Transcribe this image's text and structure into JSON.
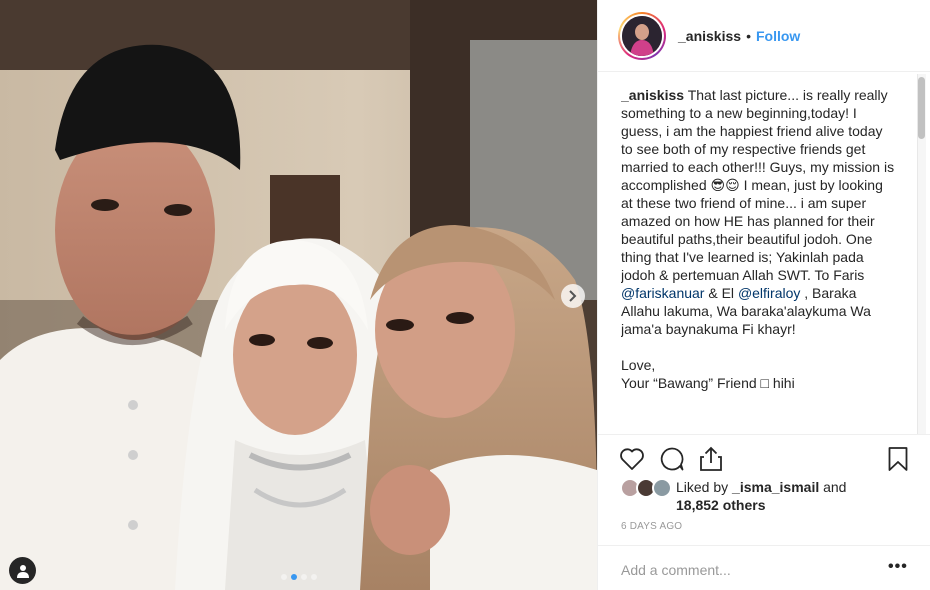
{
  "post": {
    "author": "_aniskiss",
    "separator": "•",
    "follow_label": "Follow",
    "caption": {
      "username": "_aniskiss",
      "part1": " That last picture... is really really something to a new beginning,today! I guess, i am the happiest friend alive today to see both of my respective friends get married to each other!!! Guys, my mission is accomplished 😎😌 I mean, just by looking at these two friend of mine... i am super amazed on how HE has planned for their beautiful paths,their beautiful jodoh. One thing that I've learned is; Yakinlah pada jodoh & pertemuan Allah SWT. To Faris ",
      "mention1": "@fariskanuar",
      "part2": " & El ",
      "mention2": "@elfiraloy",
      "part3": " , Baraka Allahu lakuma, Wa baraka'alaykuma Wa jama'a baynakuma Fi khayr!",
      "closing_line1": "Love,",
      "closing_line2": "Your “Bawang” Friend □ hihi"
    },
    "likes": {
      "prefix": "Liked by ",
      "user": "_isma_ismail",
      "middle": " and",
      "others": "18,852 others"
    },
    "time_ago": "6 DAYS AGO",
    "comment_placeholder": "Add a comment...",
    "more_label": "•••"
  },
  "icons": {
    "heart": "heart-icon",
    "comment": "comment-icon",
    "share": "share-icon",
    "save": "bookmark-icon",
    "next": "chevron-right-icon",
    "user_tag": "person-icon"
  },
  "carousel": {
    "count": 4,
    "active_index": 1
  },
  "colors": {
    "link": "#3897f0",
    "mention": "#003569",
    "muted": "#999999",
    "text": "#262626"
  }
}
